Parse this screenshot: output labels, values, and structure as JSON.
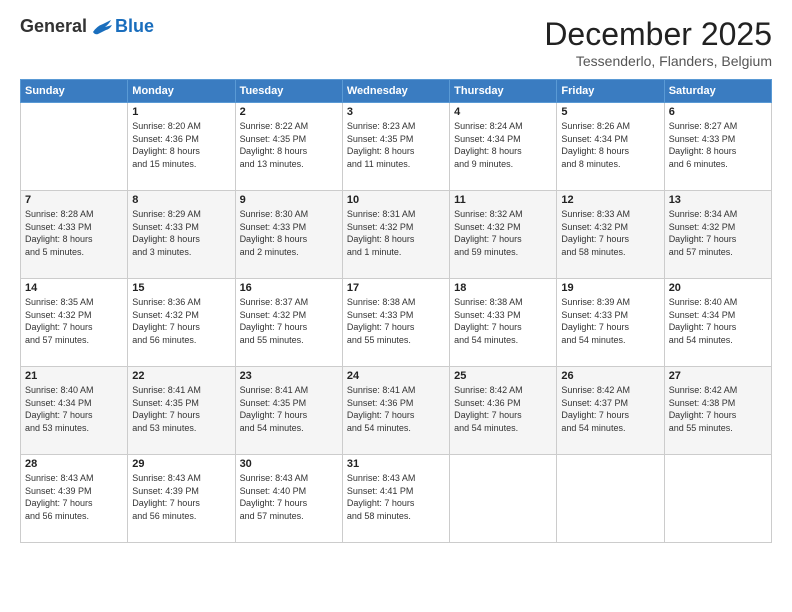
{
  "logo": {
    "general": "General",
    "blue": "Blue"
  },
  "title": "December 2025",
  "subtitle": "Tessenderlo, Flanders, Belgium",
  "weekdays": [
    "Sunday",
    "Monday",
    "Tuesday",
    "Wednesday",
    "Thursday",
    "Friday",
    "Saturday"
  ],
  "weeks": [
    [
      {
        "day": "",
        "info": ""
      },
      {
        "day": "1",
        "info": "Sunrise: 8:20 AM\nSunset: 4:36 PM\nDaylight: 8 hours\nand 15 minutes."
      },
      {
        "day": "2",
        "info": "Sunrise: 8:22 AM\nSunset: 4:35 PM\nDaylight: 8 hours\nand 13 minutes."
      },
      {
        "day": "3",
        "info": "Sunrise: 8:23 AM\nSunset: 4:35 PM\nDaylight: 8 hours\nand 11 minutes."
      },
      {
        "day": "4",
        "info": "Sunrise: 8:24 AM\nSunset: 4:34 PM\nDaylight: 8 hours\nand 9 minutes."
      },
      {
        "day": "5",
        "info": "Sunrise: 8:26 AM\nSunset: 4:34 PM\nDaylight: 8 hours\nand 8 minutes."
      },
      {
        "day": "6",
        "info": "Sunrise: 8:27 AM\nSunset: 4:33 PM\nDaylight: 8 hours\nand 6 minutes."
      }
    ],
    [
      {
        "day": "7",
        "info": "Sunrise: 8:28 AM\nSunset: 4:33 PM\nDaylight: 8 hours\nand 5 minutes."
      },
      {
        "day": "8",
        "info": "Sunrise: 8:29 AM\nSunset: 4:33 PM\nDaylight: 8 hours\nand 3 minutes."
      },
      {
        "day": "9",
        "info": "Sunrise: 8:30 AM\nSunset: 4:33 PM\nDaylight: 8 hours\nand 2 minutes."
      },
      {
        "day": "10",
        "info": "Sunrise: 8:31 AM\nSunset: 4:32 PM\nDaylight: 8 hours\nand 1 minute."
      },
      {
        "day": "11",
        "info": "Sunrise: 8:32 AM\nSunset: 4:32 PM\nDaylight: 7 hours\nand 59 minutes."
      },
      {
        "day": "12",
        "info": "Sunrise: 8:33 AM\nSunset: 4:32 PM\nDaylight: 7 hours\nand 58 minutes."
      },
      {
        "day": "13",
        "info": "Sunrise: 8:34 AM\nSunset: 4:32 PM\nDaylight: 7 hours\nand 57 minutes."
      }
    ],
    [
      {
        "day": "14",
        "info": "Sunrise: 8:35 AM\nSunset: 4:32 PM\nDaylight: 7 hours\nand 57 minutes."
      },
      {
        "day": "15",
        "info": "Sunrise: 8:36 AM\nSunset: 4:32 PM\nDaylight: 7 hours\nand 56 minutes."
      },
      {
        "day": "16",
        "info": "Sunrise: 8:37 AM\nSunset: 4:32 PM\nDaylight: 7 hours\nand 55 minutes."
      },
      {
        "day": "17",
        "info": "Sunrise: 8:38 AM\nSunset: 4:33 PM\nDaylight: 7 hours\nand 55 minutes."
      },
      {
        "day": "18",
        "info": "Sunrise: 8:38 AM\nSunset: 4:33 PM\nDaylight: 7 hours\nand 54 minutes."
      },
      {
        "day": "19",
        "info": "Sunrise: 8:39 AM\nSunset: 4:33 PM\nDaylight: 7 hours\nand 54 minutes."
      },
      {
        "day": "20",
        "info": "Sunrise: 8:40 AM\nSunset: 4:34 PM\nDaylight: 7 hours\nand 54 minutes."
      }
    ],
    [
      {
        "day": "21",
        "info": "Sunrise: 8:40 AM\nSunset: 4:34 PM\nDaylight: 7 hours\nand 53 minutes."
      },
      {
        "day": "22",
        "info": "Sunrise: 8:41 AM\nSunset: 4:35 PM\nDaylight: 7 hours\nand 53 minutes."
      },
      {
        "day": "23",
        "info": "Sunrise: 8:41 AM\nSunset: 4:35 PM\nDaylight: 7 hours\nand 54 minutes."
      },
      {
        "day": "24",
        "info": "Sunrise: 8:41 AM\nSunset: 4:36 PM\nDaylight: 7 hours\nand 54 minutes."
      },
      {
        "day": "25",
        "info": "Sunrise: 8:42 AM\nSunset: 4:36 PM\nDaylight: 7 hours\nand 54 minutes."
      },
      {
        "day": "26",
        "info": "Sunrise: 8:42 AM\nSunset: 4:37 PM\nDaylight: 7 hours\nand 54 minutes."
      },
      {
        "day": "27",
        "info": "Sunrise: 8:42 AM\nSunset: 4:38 PM\nDaylight: 7 hours\nand 55 minutes."
      }
    ],
    [
      {
        "day": "28",
        "info": "Sunrise: 8:43 AM\nSunset: 4:39 PM\nDaylight: 7 hours\nand 56 minutes."
      },
      {
        "day": "29",
        "info": "Sunrise: 8:43 AM\nSunset: 4:39 PM\nDaylight: 7 hours\nand 56 minutes."
      },
      {
        "day": "30",
        "info": "Sunrise: 8:43 AM\nSunset: 4:40 PM\nDaylight: 7 hours\nand 57 minutes."
      },
      {
        "day": "31",
        "info": "Sunrise: 8:43 AM\nSunset: 4:41 PM\nDaylight: 7 hours\nand 58 minutes."
      },
      {
        "day": "",
        "info": ""
      },
      {
        "day": "",
        "info": ""
      },
      {
        "day": "",
        "info": ""
      }
    ]
  ]
}
